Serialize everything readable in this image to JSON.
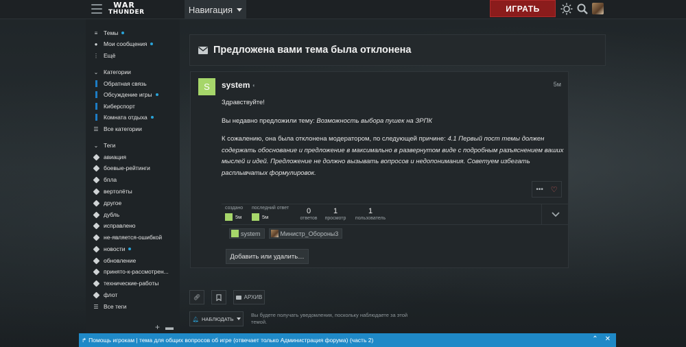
{
  "header": {
    "logo_line1": "WAR",
    "logo_line2": "THUNDER",
    "nav_label": "Навигация",
    "play_label": "ИГРАТЬ"
  },
  "sidebar": {
    "top_items": [
      {
        "label": "Темы",
        "icon": "layers-icon",
        "dot": true
      },
      {
        "label": "Мои сообщения",
        "icon": "user-icon",
        "dot": true
      },
      {
        "label": "Ещё",
        "icon": "more-vertical-icon",
        "dot": false
      }
    ],
    "categories_heading": "Категории",
    "categories": [
      {
        "label": "Обратная связь",
        "dot": false
      },
      {
        "label": "Обсуждение игры",
        "dot": true
      },
      {
        "label": "Киберспорт",
        "dot": false
      },
      {
        "label": "Комната отдыха",
        "dot": true
      }
    ],
    "all_categories": "Все категории",
    "tags_heading": "Теги",
    "tags": [
      {
        "label": "авиация",
        "dot": false
      },
      {
        "label": "боевые-рейтинги",
        "dot": false
      },
      {
        "label": "бпла",
        "dot": false
      },
      {
        "label": "вертолёты",
        "dot": false
      },
      {
        "label": "другое",
        "dot": false
      },
      {
        "label": "дубль",
        "dot": false
      },
      {
        "label": "исправлено",
        "dot": false
      },
      {
        "label": "не-является-ошибкой",
        "dot": false
      },
      {
        "label": "новости",
        "dot": true
      },
      {
        "label": "обновление",
        "dot": false
      },
      {
        "label": "принято-к-рассмотрен...",
        "dot": false
      },
      {
        "label": "технические-работы",
        "dot": false
      },
      {
        "label": "флот",
        "dot": false
      }
    ],
    "all_tags": "Все теги",
    "accent_color": "#1d7cc4",
    "dot_color": "#2aa3d8"
  },
  "topic": {
    "title": "Предложена вами тема была отклонена"
  },
  "post": {
    "avatar_letter": "S",
    "username": "system",
    "time": "5м",
    "greeting": "Здравствуйте!",
    "line2_prefix": "Вы недавно предложили тему: ",
    "line2_topic": "Возможность выбора пушек на ЗРПК",
    "line3_prefix": "К сожалению, она была отклонена модератором, по следующей причине: ",
    "line3_reason": "4.1 Первый пост темы должен содержать обоснование и предложение в максимально в развернутом виде с подробным разъяснением ваших мыслей и идей. Предложение не должно вызывать вопросов и недопонимания. Советуем избегать расплывчатых формулировок.",
    "more_icon": "•••"
  },
  "meta": {
    "created_label": "создано",
    "created_time": "5м",
    "last_reply_label": "последний ответ",
    "last_reply_time": "5м",
    "replies_count": "0",
    "replies_label": "ответов",
    "views_count": "1",
    "views_label": "просмотр",
    "users_count": "1",
    "users_label": "пользователь"
  },
  "participants": [
    {
      "name": "system"
    },
    {
      "name": "Министр_Обороны3"
    }
  ],
  "add_remove_label": "Добавить или удалить…",
  "controls": {
    "archive_label": "АРХИВ",
    "watch_label": "НАБЛЮДАТЬ",
    "watch_note": "Вы будете получать уведомления, поскольку наблюдаете за этой темой."
  },
  "banner": {
    "text": "Помощь игрокам | тема для общих вопросов об игре (отвечает только Администрация форума) (часть 2)"
  }
}
